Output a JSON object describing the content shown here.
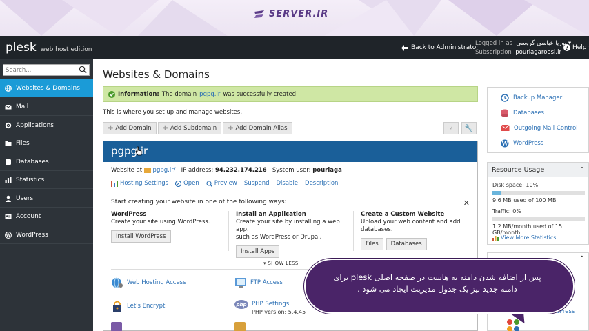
{
  "banner": {
    "brand": "SERVER.IR"
  },
  "topbar": {
    "logo": "plesk",
    "edition": "web host edition",
    "back": "Back to Administrator",
    "logged_label": "Logged in as",
    "logged_user": "پوریا عباسی گروسی",
    "subscription_label": "Subscription",
    "subscription_value": "pouriagaroosi.ir",
    "help": "Help"
  },
  "sidebar": {
    "search_placeholder": "Search...",
    "items": [
      {
        "label": "Websites & Domains"
      },
      {
        "label": "Mail"
      },
      {
        "label": "Applications"
      },
      {
        "label": "Files"
      },
      {
        "label": "Databases"
      },
      {
        "label": "Statistics"
      },
      {
        "label": "Users"
      },
      {
        "label": "Account"
      },
      {
        "label": "WordPress"
      }
    ]
  },
  "main": {
    "title": "Websites & Domains",
    "info_label": "Information:",
    "info_pre": "The domain",
    "info_domain": "pgpg.ir",
    "info_post": "was successfully created.",
    "lead": "This is where you set up and manage websites.",
    "toolbar": {
      "add_domain": "Add Domain",
      "add_subdomain": "Add Subdomain",
      "add_alias": "Add Domain Alias"
    },
    "domain": {
      "name": "pgpg.ir",
      "website_at": "Website at",
      "website_link": "pgpg.ir/",
      "ip_label": "IP address:",
      "ip": "94.232.174.216",
      "sysuser_label": "System user:",
      "sysuser": "pouriaga",
      "links": [
        "Hosting Settings",
        "Open",
        "Preview",
        "Suspend",
        "Disable",
        "Description"
      ]
    },
    "start": {
      "heading": "Start creating your website in one of the following ways:",
      "wp_title": "WordPress",
      "wp_desc": "Create your site using WordPress.",
      "wp_btn": "Install WordPress",
      "app_title": "Install an Application",
      "app_desc1": "Create your site by installing a web app.",
      "app_desc2": "such as WordPress or Drupal.",
      "app_btn": "Install Apps",
      "custom_title": "Create a Custom Website",
      "custom_desc1": "Upload your web content and add",
      "custom_desc2": "databases.",
      "files_btn": "Files",
      "db_btn": "Databases"
    },
    "show_less": "SHOW LESS",
    "services": {
      "web_hosting": "Web Hosting Access",
      "ftp": "FTP Access",
      "letsencrypt": "Let's Encrypt",
      "php": "PHP Settings",
      "php_version": "PHP version: 5.4.45",
      "php_badge": "php"
    }
  },
  "right": {
    "links": [
      "Backup Manager",
      "Databases",
      "Outgoing Mail Control",
      "WordPress"
    ],
    "resource_title": "Resource Usage",
    "disk_label": "Disk space: 10%",
    "disk_fraction": 0.1,
    "disk_detail": "9.6 MB used of 100 MB",
    "traffic_label": "Traffic: 0%",
    "traffic_fraction": 0.0,
    "traffic_detail": "1.2 MB/month used of 15 GB/month",
    "more_stats": "View More Statistics",
    "wp_partial": "ordPress"
  },
  "overlay": {
    "line1": "پس از اضافه شدن دامنه به هاست در صفحه اصلی plesk برای",
    "line2": "دامنه جدید نیز یک جدول مدیریت ایجاد می شود ."
  },
  "colors": {
    "active": "#1b9bd7",
    "header": "#1a5f99",
    "info_bg": "#cfe7a4",
    "link": "#2a6fb4",
    "overlay": "#4a2468"
  }
}
